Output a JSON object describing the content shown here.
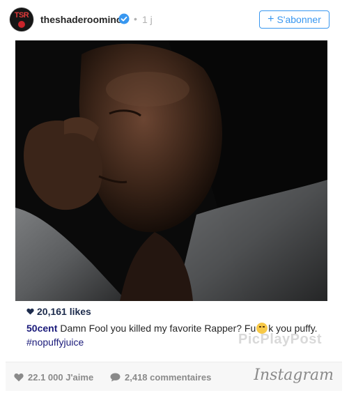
{
  "header": {
    "username": "theshaderoominc",
    "avatar_text": "TSR",
    "separator": "•",
    "time": "1 j",
    "follow_plus": "+",
    "follow_label": "S'abonner"
  },
  "post": {
    "likes": "20,161 likes",
    "caption_user": "50cent",
    "caption_text_1": "Damn Fool you killed my favorite Rapper? Fu",
    "caption_text_2": "k you puffy.",
    "caption_hashtag": "#nopuffyjuice",
    "watermark": "PicPlayPost"
  },
  "footer": {
    "likes": "22.1 000 J'aime",
    "comments": "2,418 commentaires",
    "brand": "Instagram"
  },
  "colors": {
    "accent": "#3897f0",
    "link": "#1a1a7a",
    "muted": "#8a8a8a"
  }
}
